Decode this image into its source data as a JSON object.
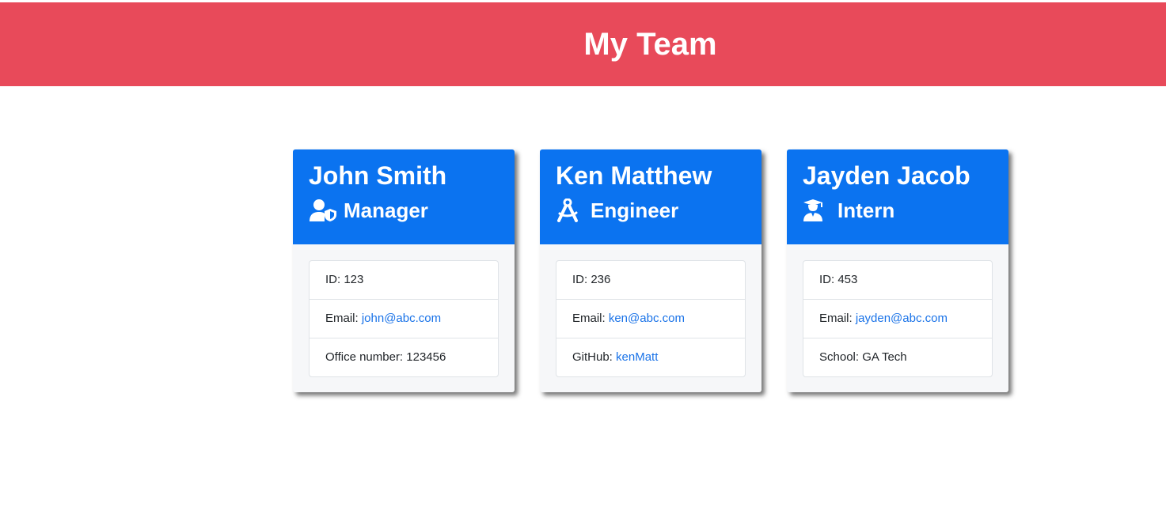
{
  "header": {
    "title": "My Team"
  },
  "team": [
    {
      "name": "John Smith",
      "role": "Manager",
      "role_icon": "manager-user-shield-icon",
      "id_label": "ID: 123",
      "email_prefix": "Email: ",
      "email": "john@abc.com",
      "extra_prefix": "Office number: 123456",
      "extra_link": ""
    },
    {
      "name": "Ken Matthew",
      "role": "Engineer",
      "role_icon": "engineer-compass-icon",
      "id_label": "ID: 236",
      "email_prefix": "Email: ",
      "email": "ken@abc.com",
      "extra_prefix": "GitHub: ",
      "extra_link": "kenMatt"
    },
    {
      "name": "Jayden Jacob",
      "role": "Intern",
      "role_icon": "intern-graduate-icon",
      "id_label": "ID: 453",
      "email_prefix": "Email: ",
      "email": "jayden@abc.com",
      "extra_prefix": "School: GA Tech",
      "extra_link": ""
    }
  ],
  "colors": {
    "header_bg": "#e84a5a",
    "card_head_bg": "#0b73f0",
    "link": "#1a73e8"
  }
}
